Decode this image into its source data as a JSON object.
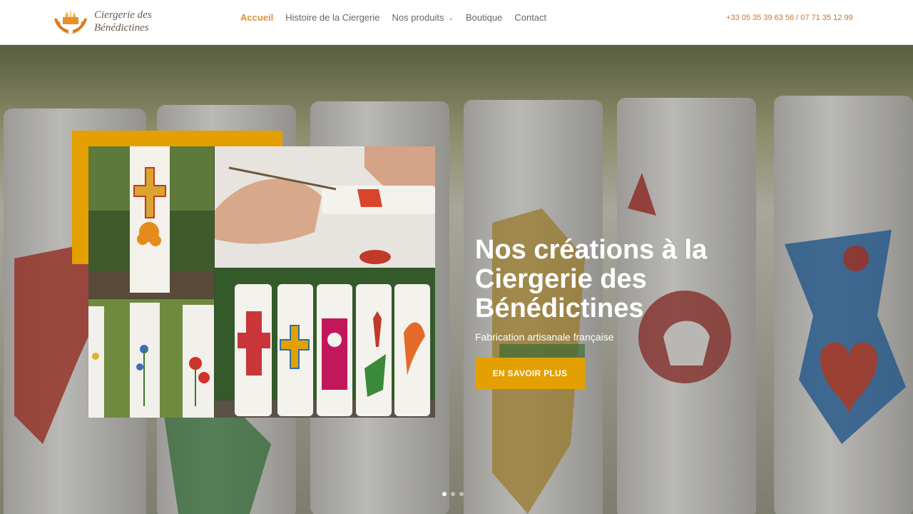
{
  "brand": {
    "line1": "Ciergerie des",
    "line2": "Bénédictines"
  },
  "nav": {
    "items": [
      {
        "label": "Accueil",
        "active": true
      },
      {
        "label": "Histoire de la Ciergerie"
      },
      {
        "label": "Nos produits",
        "dropdown": true
      },
      {
        "label": "Boutique"
      },
      {
        "label": "Contact"
      }
    ]
  },
  "phone": "+33 05 35 39 63 56 / 07 71 35 12 99",
  "hero": {
    "title": "Nos créations à la Ciergerie des Bénédictines",
    "subtitle": "Fabrication artisanale française",
    "cta_label": "EN SAVOIR PLUS",
    "slides_total": 3,
    "active_slide": 1
  },
  "colors": {
    "accent": "#e3a000",
    "nav_active": "#d9923a",
    "phone": "#c9742a"
  },
  "icons": {
    "logo": "hands-flame-logo-icon",
    "dropdown": "chevron-down-icon"
  }
}
